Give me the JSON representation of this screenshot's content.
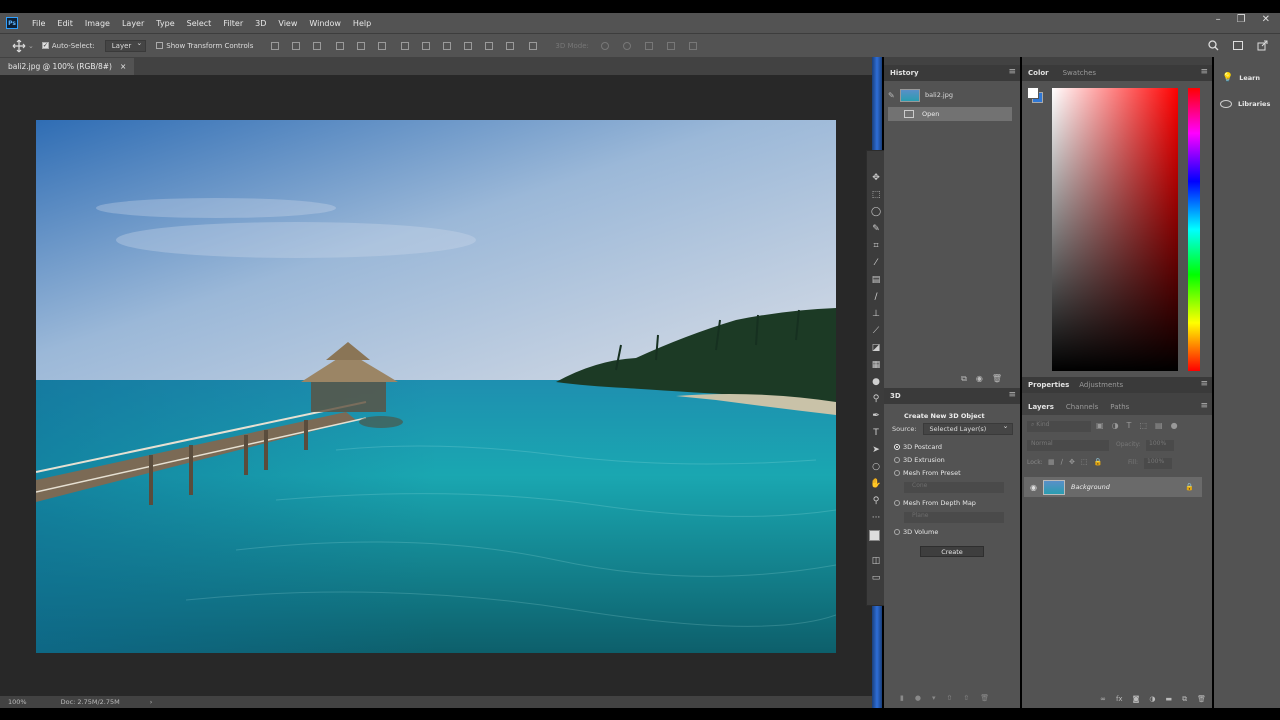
{
  "app": {
    "logo": "Ps"
  },
  "menu": [
    "File",
    "Edit",
    "Image",
    "Layer",
    "Type",
    "Select",
    "Filter",
    "3D",
    "View",
    "Window",
    "Help"
  ],
  "window_controls": [
    "–",
    "❐",
    "✕"
  ],
  "options": {
    "auto_select_label": "Auto-Select:",
    "auto_select_checked": true,
    "auto_select_value": "Layer",
    "transform_controls_label": "Show Transform Controls",
    "mode_3d_label": "3D Mode:"
  },
  "document": {
    "tab_title": "bali2.jpg @ 100% (RGB/8#)",
    "close_glyph": "×",
    "zoom": "100%",
    "doc_size": "Doc: 2.75M/2.75M",
    "arrow": "›"
  },
  "history": {
    "title": "History",
    "snapshot": "bali2.jpg",
    "items": [
      "Open"
    ]
  },
  "panel_3d": {
    "title": "3D",
    "heading": "Create New 3D Object",
    "source_label": "Source:",
    "source_value": "Selected Layer(s)",
    "options": [
      "3D Postcard",
      "3D Extrusion",
      "Mesh From Preset",
      "Mesh From Depth Map",
      "3D Volume"
    ],
    "selected": "3D Postcard",
    "preset_placeholder": "Cone",
    "depth_placeholder": "Plane",
    "create_label": "Create"
  },
  "color_panel": {
    "tabs": [
      "Color",
      "Swatches"
    ],
    "foreground": "#ffffff",
    "background": "#2f78d6",
    "hue": "#ff0000"
  },
  "properties": {
    "tabs": [
      "Properties",
      "Adjustments"
    ]
  },
  "layers": {
    "tabs": [
      "Layers",
      "Channels",
      "Paths"
    ],
    "kind_placeholder": "Kind",
    "blend_mode": "Normal",
    "opacity_label": "Opacity:",
    "opacity_value": "100%",
    "lock_label": "Lock:",
    "fill_label": "Fill:",
    "fill_value": "100%",
    "layer_name": "Background"
  },
  "right_panel": {
    "items": [
      "Learn",
      "Libraries"
    ]
  },
  "colors": {
    "accent": "#2e6ed8",
    "panel": "#535353",
    "dark": "#424242"
  }
}
